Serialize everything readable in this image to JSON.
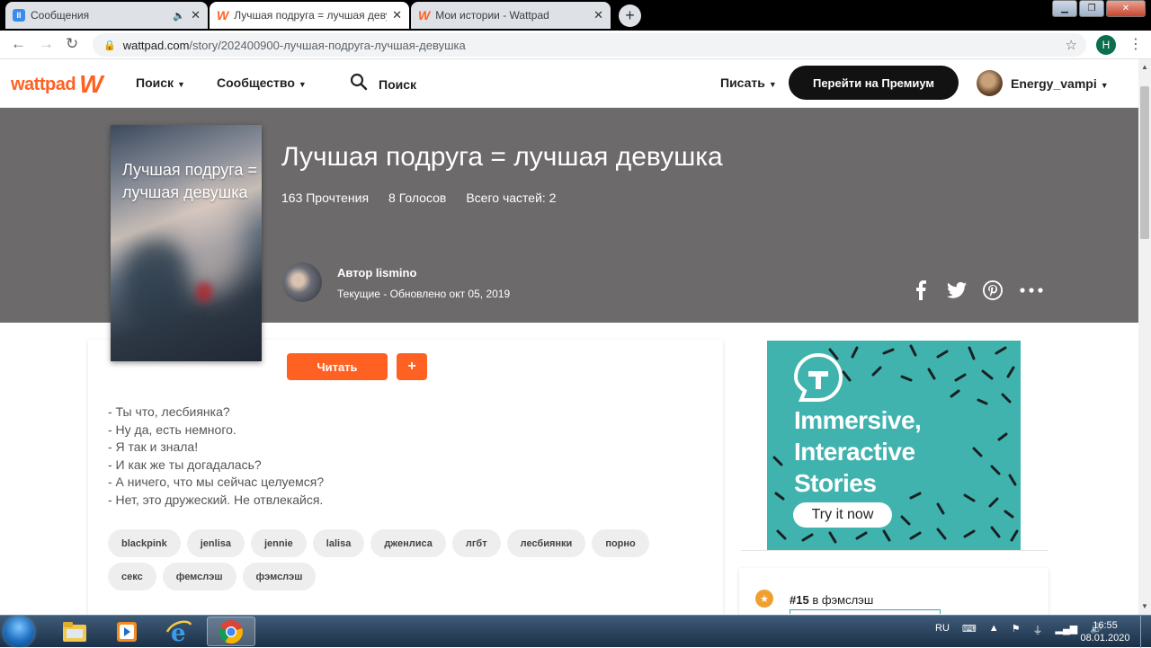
{
  "browser": {
    "tabs": [
      {
        "title": "Сообщения",
        "favicon": "messages-icon",
        "audio": true
      },
      {
        "title": "Лучшая подруга = лучшая девушка",
        "favicon": "wattpad-icon",
        "active": true
      },
      {
        "title": "Мои истории - Wattpad",
        "favicon": "wattpad-icon"
      }
    ],
    "url_host": "wattpad.com",
    "url_path": "/story/202400900-лучшая-подруга-лучшая-девушка",
    "profile_initial": "Н"
  },
  "header": {
    "logo_text": "wattpad",
    "logo_mark": "W",
    "nav_search": "Поиск",
    "nav_community": "Сообщество",
    "search_placeholder": "Поиск",
    "write": "Писать",
    "premium": "Перейти на Премиум",
    "username": "Energy_vampi"
  },
  "story": {
    "title": "Лучшая подруга = лучшая девушка",
    "cover_title": "Лучшая подруга = лучшая девушка",
    "reads": "163 Прочтения",
    "votes": "8 Голосов",
    "parts": "Всего частей: 2",
    "author": "Автор lismino",
    "status": "Текущие - Обновлено окт 05, 2019",
    "read_button": "Читать",
    "add_button": "+",
    "description": [
      "- Ты что, лесбиянка?",
      "- Ну да, есть немного.",
      "- Я так и знала!",
      "- И как же ты догадалась?",
      "- А ничего, что мы сейчас целуемся?",
      "- Нет, это дружеский. Не отвлекайся."
    ],
    "tags": [
      "blackpink",
      "jenlisa",
      "jennie",
      "lalisa",
      "дженлиса",
      "лгбт",
      "лесбиянки",
      "порно",
      "секс",
      "фемслэш",
      "фэмслэш"
    ]
  },
  "share": [
    "facebook-icon",
    "twitter-icon",
    "pinterest-icon",
    "more-icon"
  ],
  "ad": {
    "headline_1": "Immersive,",
    "headline_2": "Interactive",
    "headline_3": "Stories",
    "cta": "Try it now"
  },
  "ranking": {
    "rank": "#15",
    "text": " в фэмслэш"
  },
  "taskbar": {
    "lang": "RU",
    "time": "16:55",
    "date": "08.01.2020"
  },
  "colors": {
    "wattpad_orange": "#ff6122",
    "banner": "#6c6a6a",
    "ad_teal": "#40b3ae",
    "premium_black": "#121212"
  }
}
